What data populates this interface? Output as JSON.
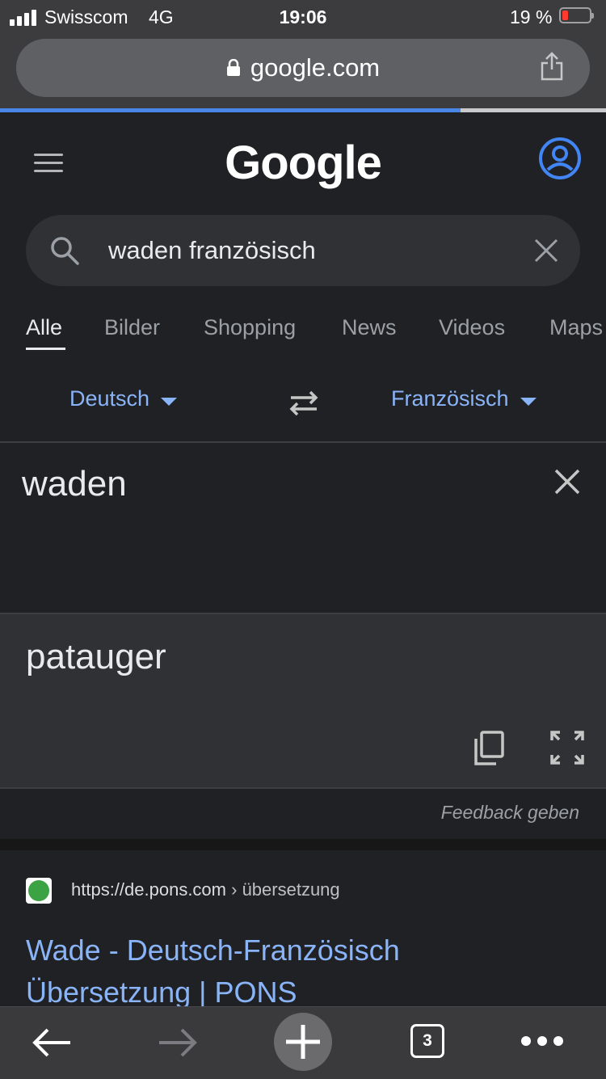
{
  "status_bar": {
    "carrier": "Swisscom",
    "network": "4G",
    "time": "19:06",
    "battery": "19 %"
  },
  "browser": {
    "url": "google.com",
    "load_progress_percent": 76,
    "tab_count": "3"
  },
  "google": {
    "logo": "Google"
  },
  "search": {
    "query": "waden französisch"
  },
  "tabs": [
    "Alle",
    "Bilder",
    "Shopping",
    "News",
    "Videos",
    "Maps"
  ],
  "translate": {
    "source_language": "Deutsch",
    "target_language": "Französisch",
    "source_text": "waden",
    "translated_text": "patauger",
    "feedback": "Feedback geben"
  },
  "result": {
    "url": "https://de.pons.com",
    "url_path": "› übersetzung",
    "title_line1": "Wade - Deutsch-Französisch",
    "title_line2": "Übersetzung | PONS"
  },
  "colors": {
    "accent": "#8ab4f8",
    "progress": "#4a86e8",
    "account_icon": "#4285f4",
    "battery_low": "#ff3b30",
    "site_favicon": "#3ca345"
  }
}
